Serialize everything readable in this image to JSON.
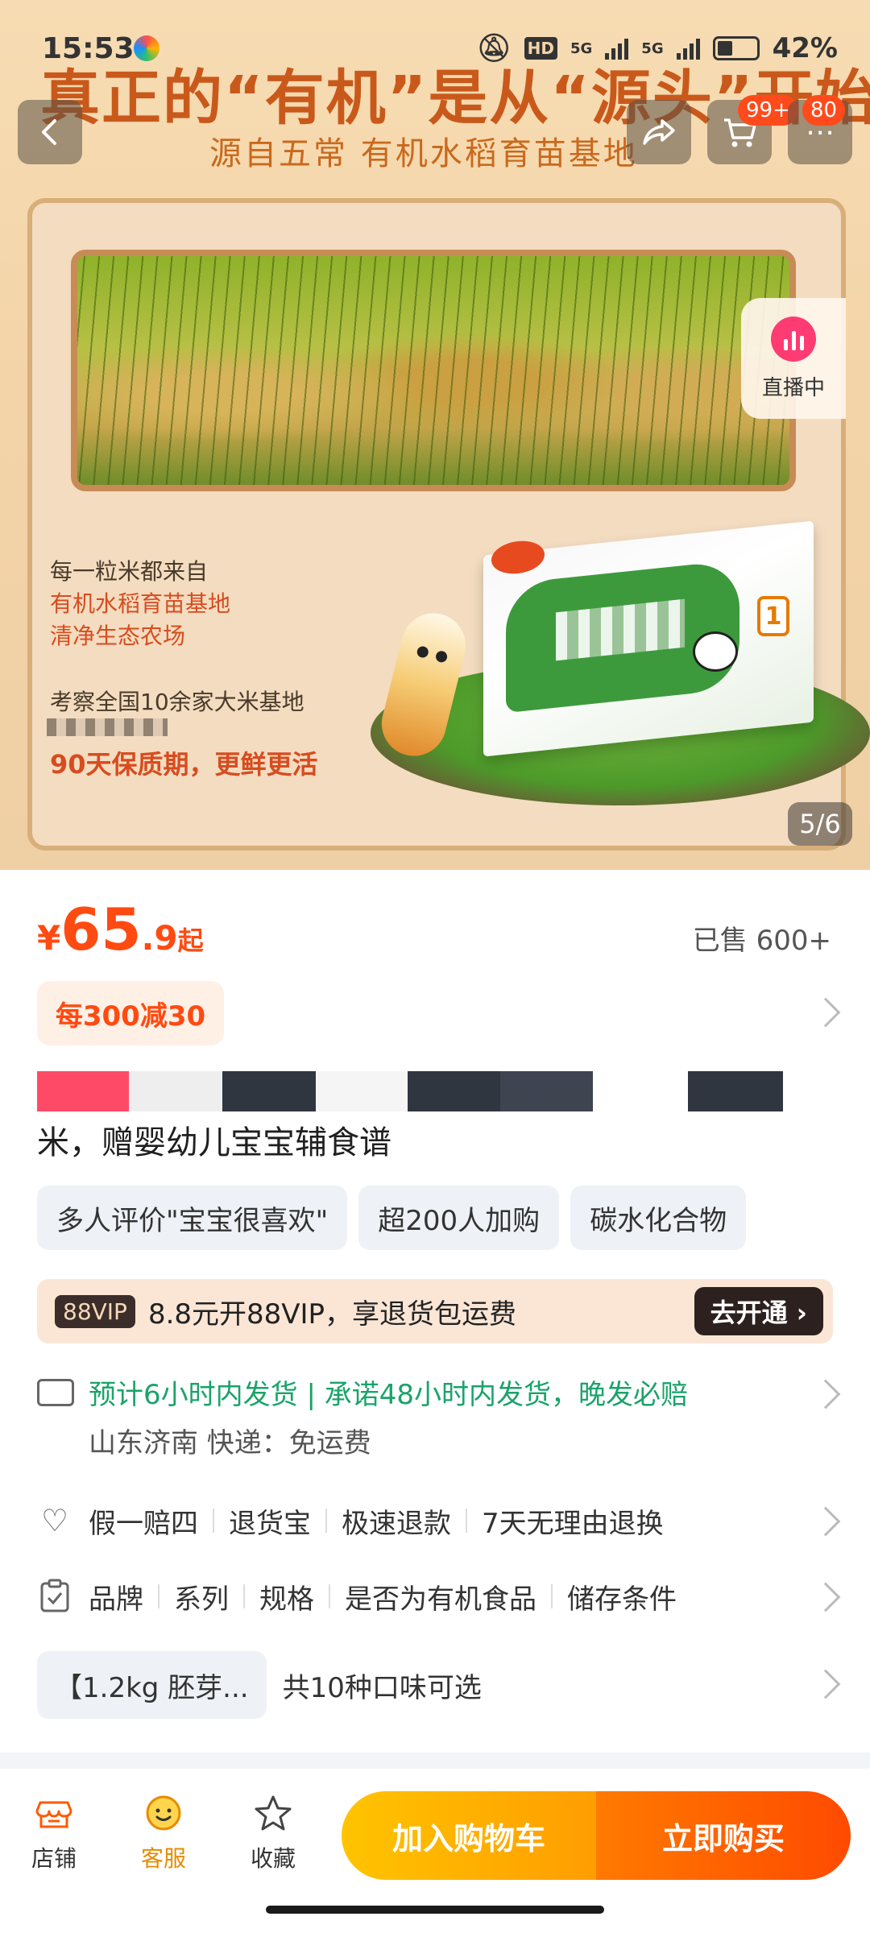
{
  "status_bar": {
    "time": "15:53",
    "network_1": "5G",
    "network_2": "5G",
    "hd": "HD",
    "battery": "42%"
  },
  "nav": {
    "cart_badge": "99+",
    "more_badge": "80"
  },
  "hero": {
    "headline": "真正的“有机”是从“源头”开始",
    "subline": "源自五常 有机水稻育苗基地",
    "text_1": "每一粒米都来自",
    "text_2": "有机水稻育苗基地",
    "text_3": "清净生态农场",
    "text_4": "考察全国10余家大米基地",
    "text_5": "90天保质期，更鲜更活",
    "box_number": "1",
    "live_label": "直播中",
    "page_indicator": "5/6"
  },
  "price": {
    "symbol": "¥",
    "integer": "65",
    "decimal": ".9",
    "suffix": "起",
    "sold": "已售 600+"
  },
  "coupon": "每300减30",
  "product_title_line2": "米，赠婴幼儿宝宝辅食谱",
  "tags": [
    "多人评价\"宝宝很喜欢\"",
    "超200人加购",
    "碳水化合物"
  ],
  "vip": {
    "badge": "88VIP",
    "text": "8.8元开88VIP，享退货包运费",
    "button": "去开通 ›"
  },
  "shipping": {
    "line1": "预计6小时内发货 | 承诺48小时内发货，晚发必赔",
    "line2": "山东济南  快递：免运费"
  },
  "services": [
    "假一赔四",
    "退货宝",
    "极速退款",
    "7天无理由退换"
  ],
  "params": [
    "品牌",
    "系列",
    "规格",
    "是否为有机食品",
    "储存条件"
  ],
  "variant": {
    "chip": "【1.2kg 胚芽...",
    "text": "共10种口味可选"
  },
  "bottom_bar": {
    "store": "店铺",
    "service": "客服",
    "favorite": "收藏",
    "add_cart": "加入购物车",
    "buy_now": "立即购买"
  },
  "colors": {
    "accent": "#ff4a12",
    "green": "#1aa36a",
    "cta_yellow": "#ffc400",
    "cta_orange": "#ff4a00"
  }
}
